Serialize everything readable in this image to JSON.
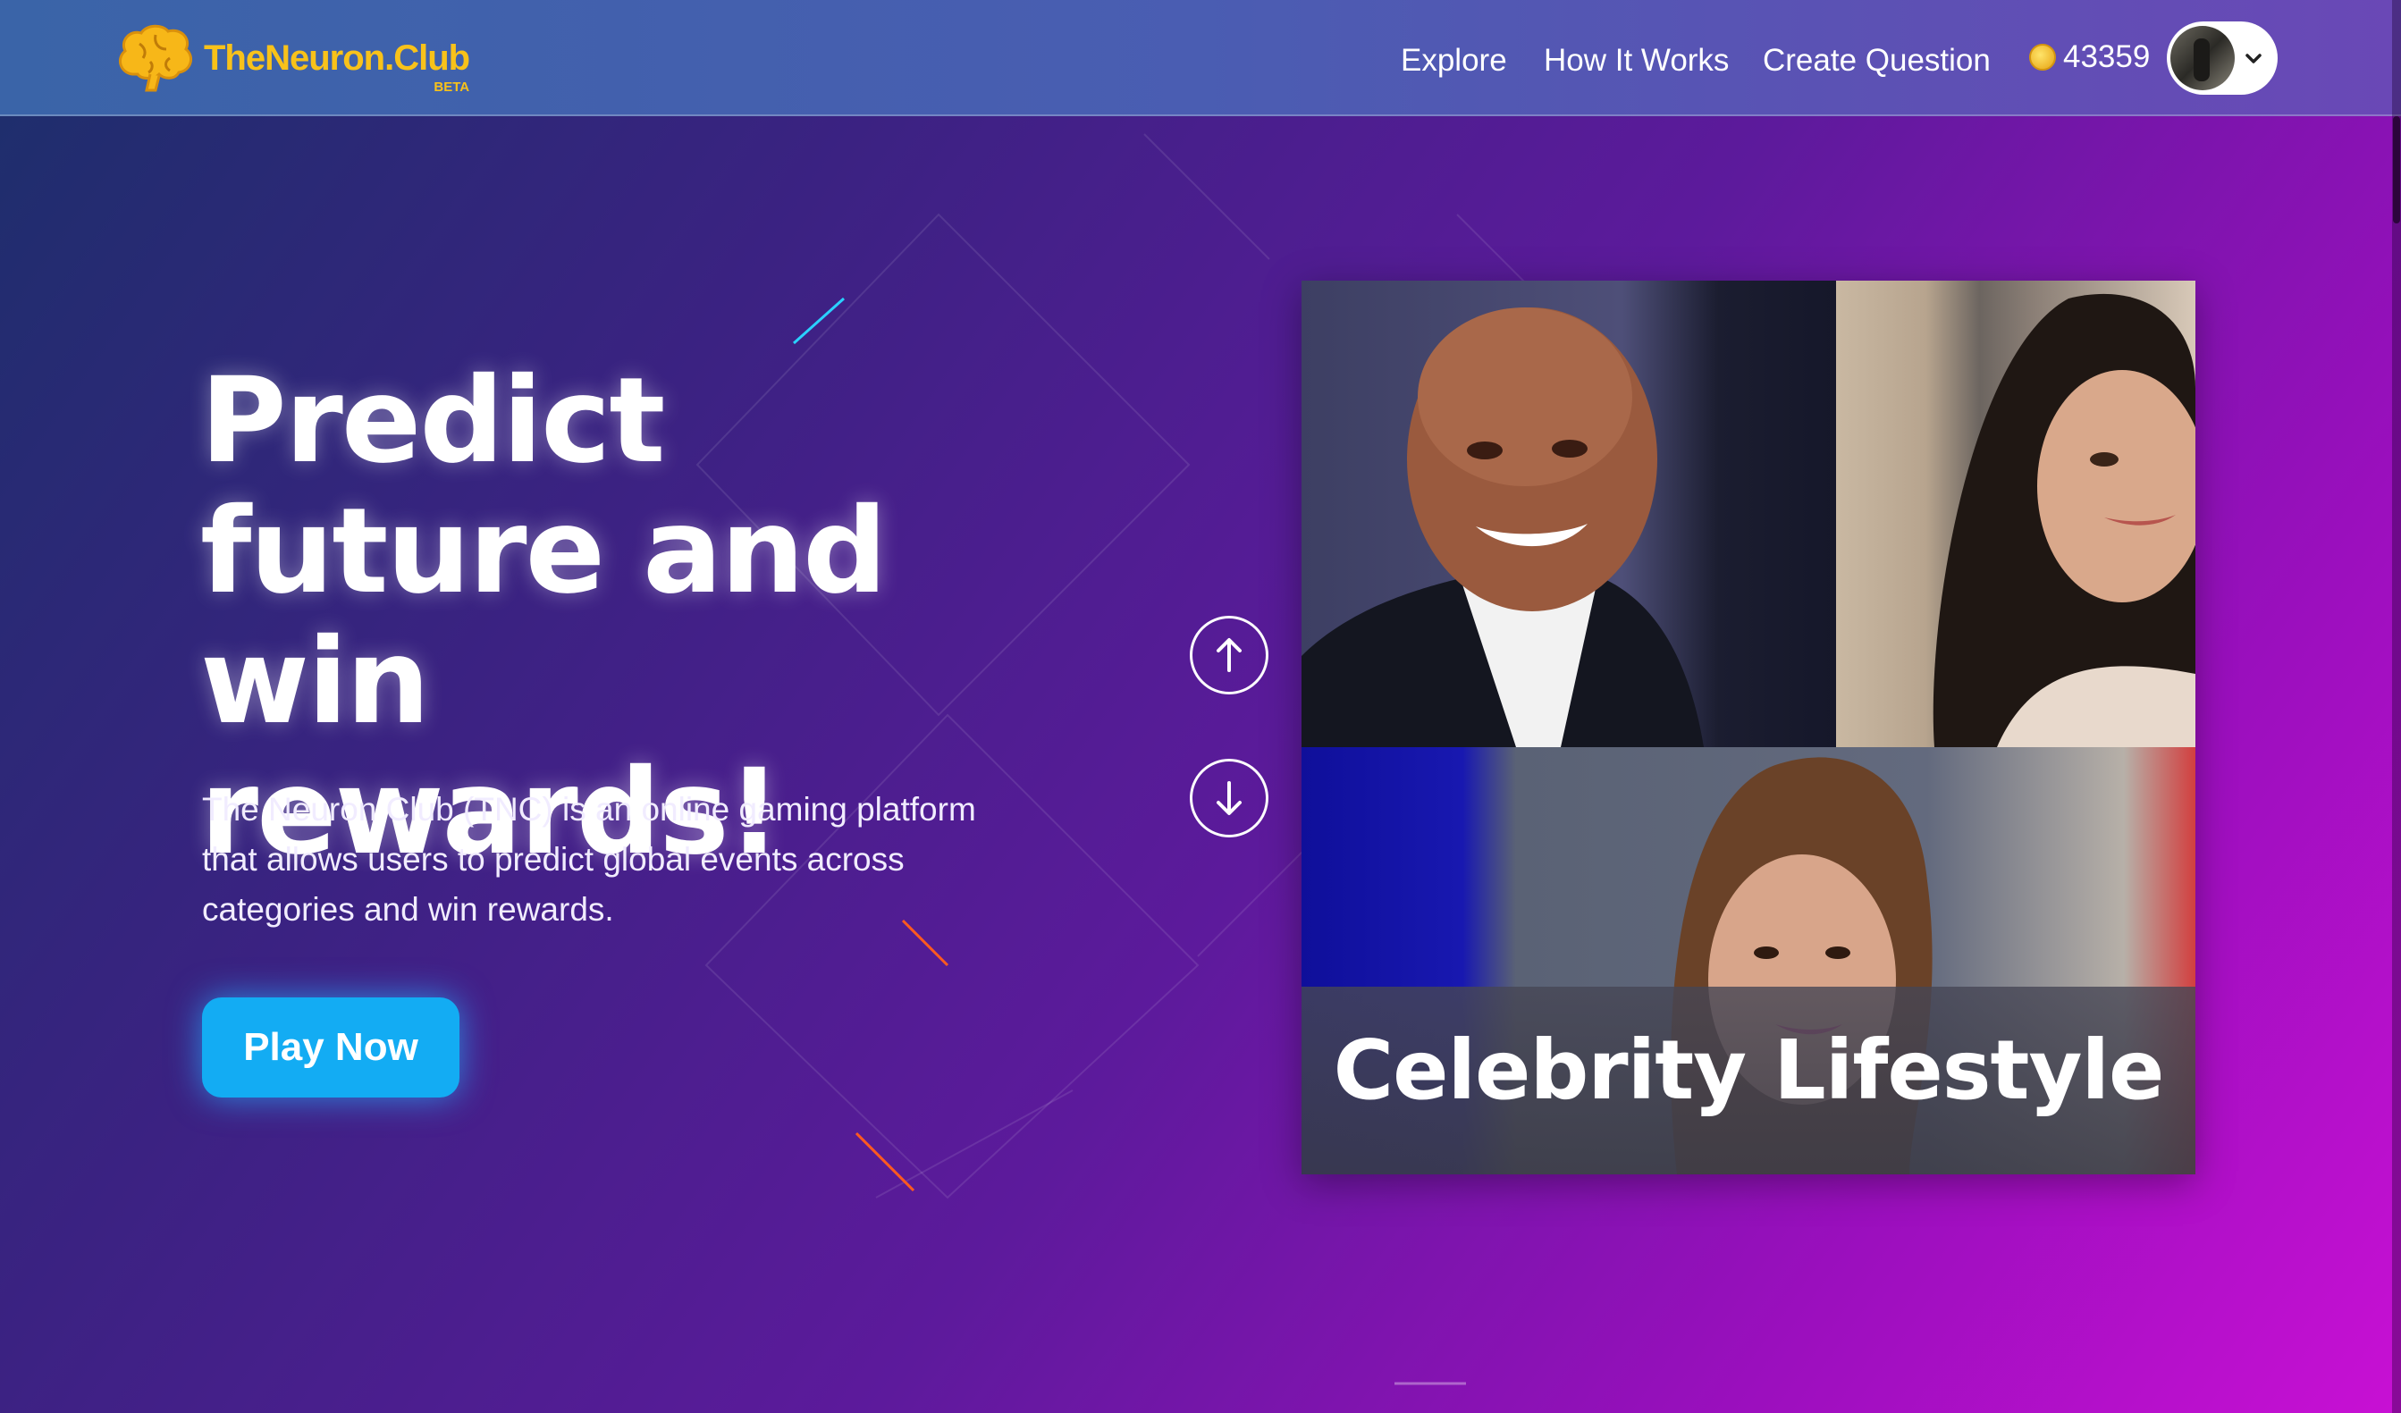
{
  "header": {
    "logo_title": "TheNeuron.Club",
    "logo_badge": "BETA",
    "nav": {
      "explore": "Explore",
      "how_it_works": "How It Works",
      "create_question": "Create Question"
    },
    "coins": "43359"
  },
  "hero": {
    "title_line1": "Predict",
    "title_line2": "future and",
    "title_line3": "win rewards!",
    "description": "The Neuron Club (TNC) is an online gaming platform that allows users to predict global events across categories and win rewards.",
    "cta_label": "Play Now"
  },
  "carousel": {
    "category_label": "Celebrity Lifestyle"
  },
  "colors": {
    "accent_blue": "#13acf3",
    "brand_yellow": "#f8c21a",
    "bg_start": "#1c2f6b",
    "bg_end": "#c810d4"
  },
  "icons": {
    "logo": "brain-icon",
    "coin": "coin-icon",
    "profile_menu": "chevron-down-icon",
    "prev": "arrow-up-icon",
    "next": "arrow-down-icon"
  }
}
